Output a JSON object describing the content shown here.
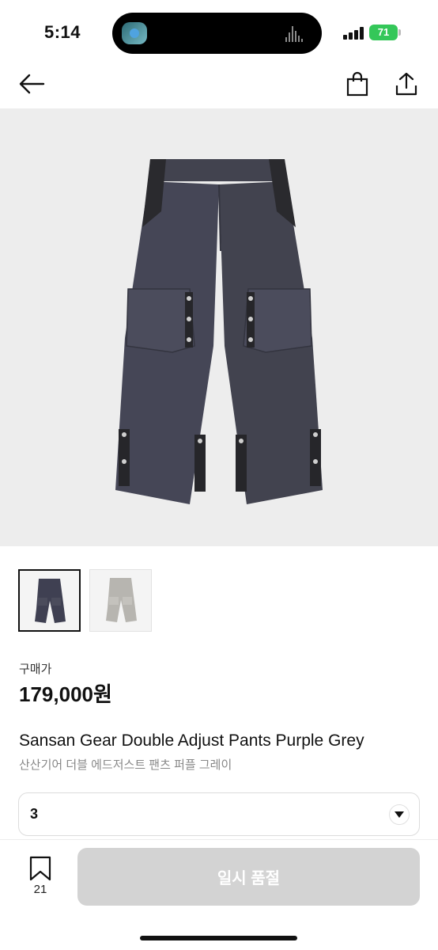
{
  "status_bar": {
    "time": "5:14",
    "battery": "71"
  },
  "nav": {
    "back_icon": "arrow-left-icon",
    "bag_icon": "shopping-bag-icon",
    "share_icon": "share-icon"
  },
  "product": {
    "image_icon": "pants-product-image",
    "thumbnails": [
      {
        "variant": "purple-grey",
        "color": "#3f4052"
      },
      {
        "variant": "grey",
        "color": "#b7b5b0"
      }
    ],
    "price_label": "구매가",
    "price": "179,000원",
    "name_en": "Sansan Gear Double Adjust Pants Purple Grey",
    "name_ko": "산산기어 더블 에드저스트 팬츠 퍼플 그레이"
  },
  "size_select": {
    "value": "3"
  },
  "bottom_bar": {
    "bookmark_count": "21",
    "soldout_label": "일시 품절"
  },
  "colors": {
    "accent_battery": "#34c759",
    "disabled_button": "#d3d3d3",
    "hero_bg": "#ededed"
  }
}
